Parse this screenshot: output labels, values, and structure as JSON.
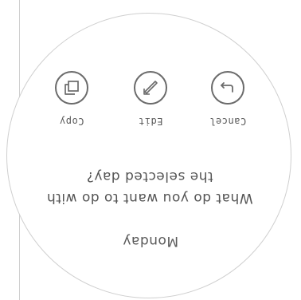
{
  "dialog": {
    "day": "Monday",
    "question": "What do you want to do with the selected day?",
    "actions": [
      {
        "id": "cancel",
        "label": "Cancel",
        "icon": "return-arrow-icon"
      },
      {
        "id": "edit",
        "label": "Edit",
        "icon": "edit-arrow-icon"
      },
      {
        "id": "copy",
        "label": "Copy",
        "icon": "copy-icon"
      }
    ]
  },
  "colors": {
    "border": "#cfcfcf",
    "text": "#555555",
    "icon": "#6b6b6b"
  }
}
